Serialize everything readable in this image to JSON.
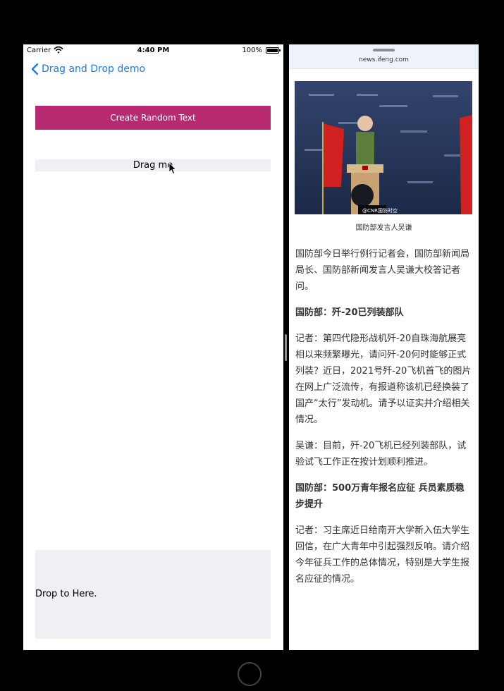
{
  "status_bar": {
    "carrier": "Carrier",
    "time": "4:40 PM",
    "battery": "100%"
  },
  "nav": {
    "back_label": "Drag and Drop demo"
  },
  "create_button": {
    "label": "Create Random Text"
  },
  "drag_item": {
    "label": "Drag me"
  },
  "drop_zone": {
    "label": "Drop to Here."
  },
  "browser": {
    "url": "news.ifeng.com"
  },
  "article": {
    "image_watermark": "@CNR国防时空",
    "image_caption": "国防部发言人吴谦",
    "paragraphs": [
      {
        "text": "国防部今日举行例行记者会，国防部新闻局局长、国防部新闻发言人吴谦大校答记者问。",
        "heading": false
      },
      {
        "text": "国防部：歼-20已列装部队",
        "heading": true
      },
      {
        "text": "记者：第四代隐形战机歼-20自珠海航展亮相以来频繁曝光，请问歼-20何时能够正式列装？近日，2021号歼-20飞机首飞的图片在网上广泛流传，有报道称该机已经换装了国产“太行”发动机。请予以证实并介绍相关情况。",
        "heading": false
      },
      {
        "text": "吴谦：目前，歼-20飞机已经列装部队，试验试飞工作正在按计划顺利推进。",
        "heading": false
      },
      {
        "text": "国防部：500万青年报名应征 兵员素质稳步提升",
        "heading": true
      },
      {
        "text": "记者：习主席近日给南开大学新入伍大学生回信，在广大青年中引起强烈反响。请介绍今年征兵工作的总体情况，特别是大学生报名应征的情况。",
        "heading": false
      }
    ]
  },
  "colors": {
    "accent": "#1a7cf5",
    "button": "#b72a72",
    "surface": "#efeff4",
    "flag": "#d0201f"
  },
  "icons": [
    "wifi-icon",
    "battery-icon",
    "chevron-left-icon",
    "cursor-icon"
  ]
}
